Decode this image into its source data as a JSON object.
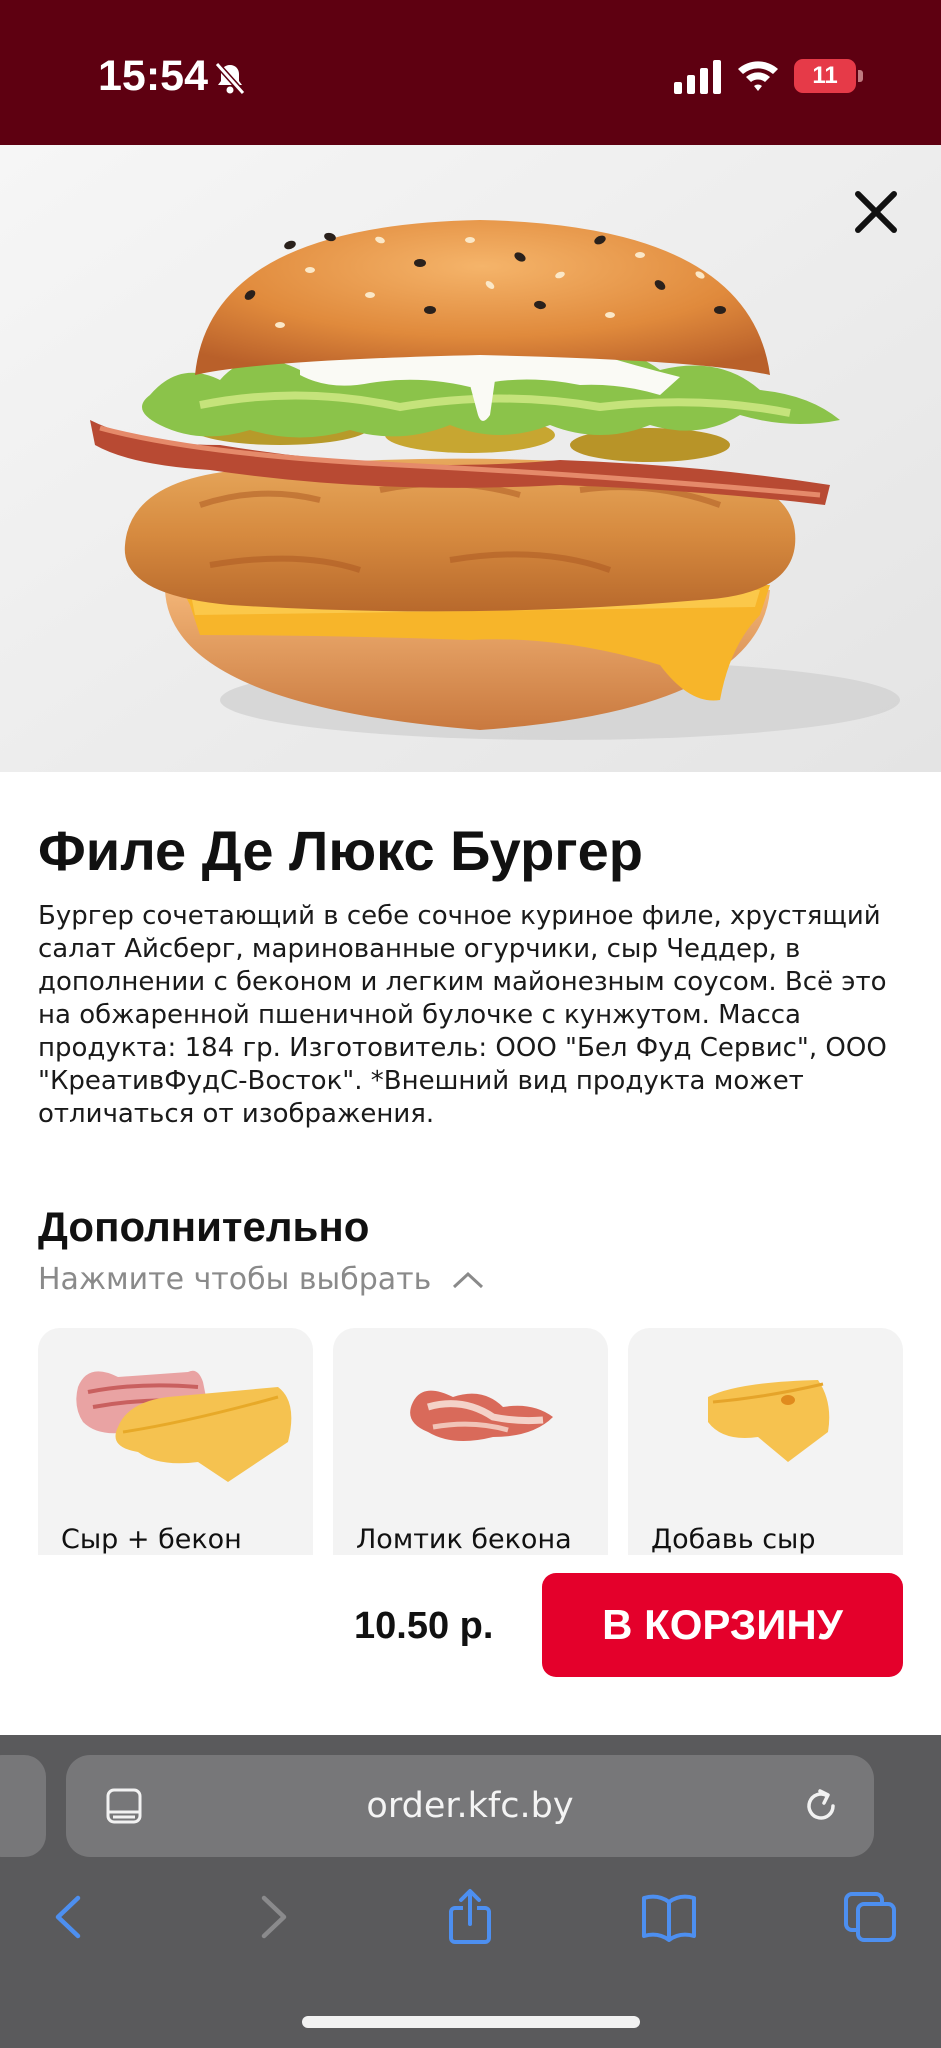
{
  "status_bar": {
    "time": "15:54",
    "battery": "11",
    "icons": [
      "bell-slash-icon",
      "cellular-signal-icon",
      "wifi-icon",
      "battery-icon"
    ]
  },
  "product": {
    "title": "Филе Де Люкс Бургер",
    "description": "Бургер сочетающий в себе сочное куриное филе, хрустящий салат Айсберг, маринованные огурчики, сыр Чеддер, в дополнении с беконом и легким майонезным соусом. Всё это на обжаренной пшеничной булочке с кунжутом. Масса продукта: 184 гр. Изготовитель: ООО \"Бел Фуд Сервис\", ООО \"КреативФудС-Восток\". *Внешний вид продукта может отличаться от изображения."
  },
  "additional": {
    "title": "Дополнительно",
    "hint": "Нажмите чтобы выбрать",
    "items": [
      {
        "label": "Сыр + бекон"
      },
      {
        "label": "Ломтик бекона"
      },
      {
        "label": "Добавь сыр"
      }
    ]
  },
  "cart": {
    "price": "10.50 р.",
    "button_label": "В КОРЗИНУ"
  },
  "browser": {
    "url": "order.kfc.by"
  },
  "colors": {
    "brand_red": "#e4002b",
    "status_bar": "#5e0011",
    "browser_chrome": "#5a5a5c",
    "toolbar_icon": "#4d8ff0"
  }
}
